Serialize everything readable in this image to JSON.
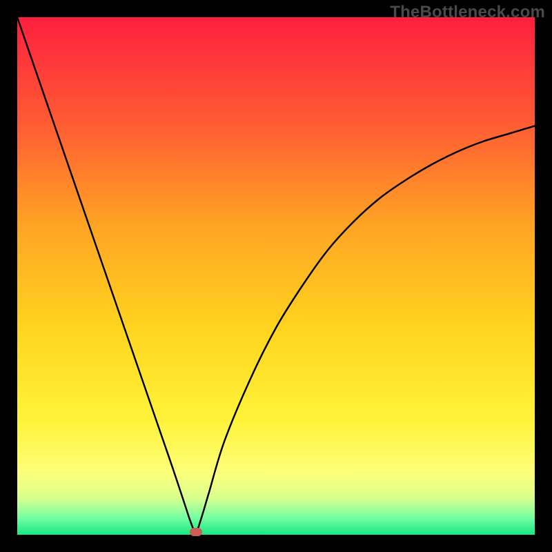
{
  "attribution": "TheBottleneck.com",
  "colors": {
    "frame": "#000000",
    "curve": "#000000",
    "marker": "#cb5f55",
    "gradient_stops": [
      {
        "offset": 0.0,
        "color": "#ff1f3f"
      },
      {
        "offset": 0.2,
        "color": "#ff5a33"
      },
      {
        "offset": 0.4,
        "color": "#ffa324"
      },
      {
        "offset": 0.6,
        "color": "#ffd41e"
      },
      {
        "offset": 0.78,
        "color": "#fff33a"
      },
      {
        "offset": 0.88,
        "color": "#fdff7a"
      },
      {
        "offset": 0.93,
        "color": "#d8ff8e"
      },
      {
        "offset": 0.965,
        "color": "#7bffa3"
      },
      {
        "offset": 1.0,
        "color": "#17e884"
      }
    ]
  },
  "chart_data": {
    "type": "line",
    "title": "",
    "xlabel": "",
    "ylabel": "",
    "xlim": [
      0,
      100
    ],
    "ylim": [
      0,
      100
    ],
    "note": "V-shaped bottleneck curve. x is a normalized hardware balance axis; y is bottleneck percentage. Minimum bottleneck ≈ 0% occurs near x ≈ 34.5. Left branch rises steeply to ≈100% at x=0; right branch rises with diminishing slope toward ≈79% at x=100.",
    "series": [
      {
        "name": "bottleneck-curve",
        "x": [
          0,
          5,
          10,
          15,
          20,
          25,
          28,
          30,
          32,
          33.5,
          34.5,
          35.5,
          37,
          40,
          45,
          50,
          55,
          60,
          65,
          70,
          75,
          80,
          85,
          90,
          95,
          100
        ],
        "y": [
          100,
          85.5,
          71,
          56.5,
          42,
          27.5,
          18.8,
          13,
          7,
          2.5,
          0.5,
          3,
          8,
          18,
          30,
          40,
          48,
          55,
          60.5,
          65,
          68.5,
          71.5,
          74,
          76,
          77.5,
          79
        ]
      }
    ],
    "marker": {
      "x": 34.5,
      "y": 0.5
    }
  }
}
